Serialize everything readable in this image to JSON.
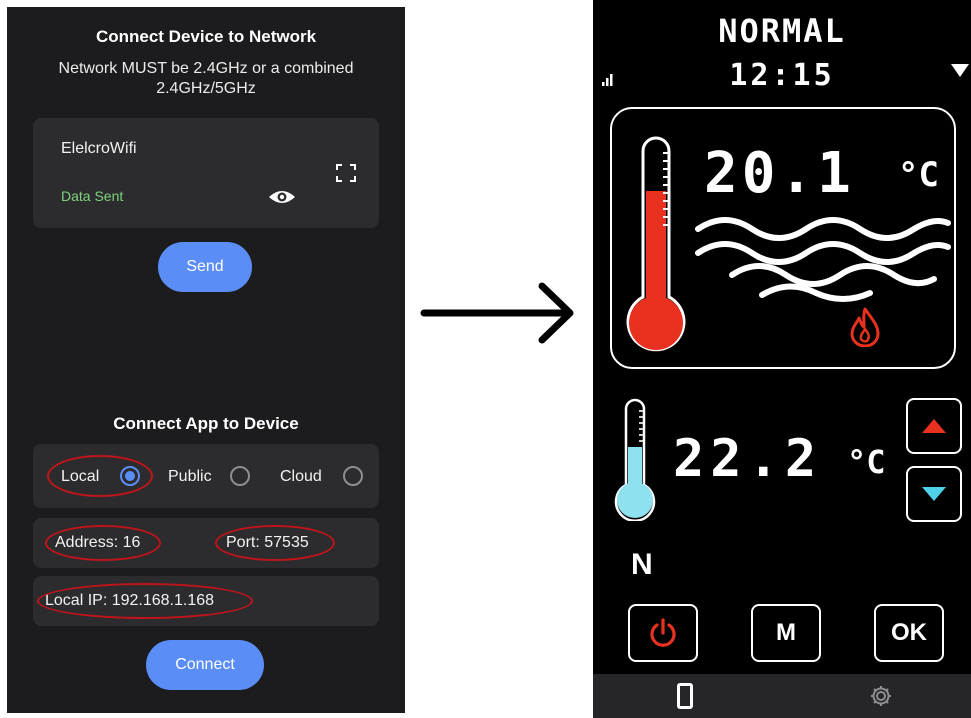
{
  "left_app": {
    "network_section": {
      "title": "Connect Device to Network",
      "note": "Network MUST be 2.4GHz or a combined 2.4GHz/5GHz",
      "wifi_name": "ElelcroWifi",
      "status": "Data Sent",
      "send_label": "Send"
    },
    "device_section": {
      "title": "Connect App to Device",
      "options": [
        "Local",
        "Public",
        "Cloud"
      ],
      "selected": "Local",
      "address_label": "Address:",
      "address_value": "16",
      "port_label": "Port:",
      "port_value": "57535",
      "ip_label": "Local IP:",
      "ip_value": "192.168.1.168",
      "connect_label": "Connect"
    }
  },
  "device": {
    "mode": "NORMAL",
    "time": "12:15",
    "water_temp": "20.1",
    "water_unit": "°C",
    "set_temp": "22.2",
    "set_unit": "°C",
    "mode_letter": "N",
    "buttons": {
      "power_icon": "power-icon",
      "menu": "M",
      "ok": "OK"
    },
    "nav_icons": [
      "phone-icon",
      "gear-icon"
    ]
  },
  "colors": {
    "accent_blue": "#5b8df7",
    "status_green": "#7ed37e",
    "highlight_red": "#c0141b",
    "thermo_red": "#e8321f",
    "thermo_cyan": "#8fe1f0"
  }
}
